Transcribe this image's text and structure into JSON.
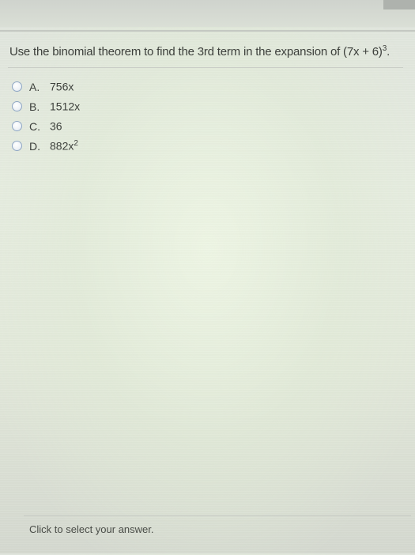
{
  "question": {
    "text": "Use the binomial theorem to find the 3rd term in the expansion of (7x + 6)",
    "exponent": "3",
    "trailing": "."
  },
  "options": [
    {
      "letter": "A.",
      "value": "756x",
      "exponent": ""
    },
    {
      "letter": "B.",
      "value": "1512x",
      "exponent": ""
    },
    {
      "letter": "C.",
      "value": "36",
      "exponent": ""
    },
    {
      "letter": "D.",
      "value": "882x",
      "exponent": "2"
    }
  ],
  "footer": {
    "hint": "Click to select your answer."
  },
  "colors": {
    "radio_border": "#8fa7c4",
    "text": "#3d403c"
  }
}
